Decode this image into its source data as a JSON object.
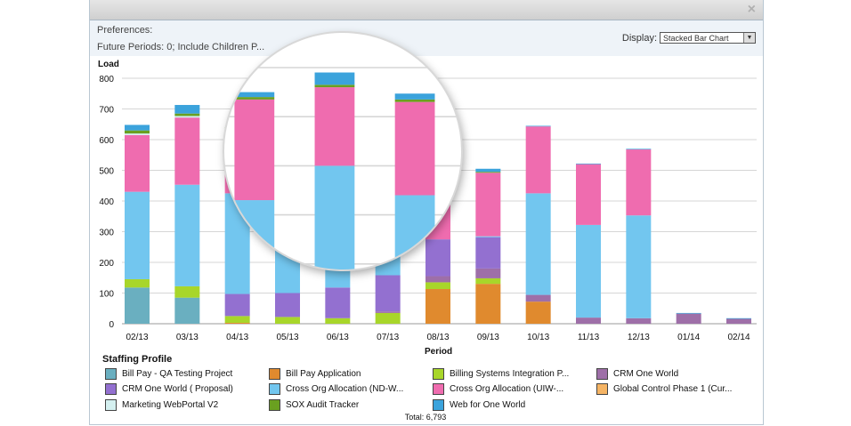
{
  "window": {
    "close_label": "×"
  },
  "preferences": {
    "title": "Preferences:",
    "summary": "Future Periods: 0; Include Children P...",
    "display_label": "Display:",
    "display_value": "Stacked Bar Chart"
  },
  "chart_data": {
    "type": "bar",
    "stacked": true,
    "ylabel": "Load",
    "xlabel": "Period",
    "ylim": [
      0,
      800
    ],
    "yticks": [
      0,
      100,
      200,
      300,
      400,
      500,
      600,
      700,
      800
    ],
    "grid": true,
    "categories": [
      "02/13",
      "03/13",
      "04/13",
      "05/13",
      "06/13",
      "07/13",
      "08/13",
      "09/13",
      "10/13",
      "11/13",
      "12/13",
      "01/14",
      "02/14"
    ],
    "legend_title": "Staffing Profile",
    "legend_position": "bottom",
    "series": [
      {
        "name": "Bill Pay - QA Testing Project",
        "color": "#6aafc0",
        "values": [
          118,
          85,
          0,
          0,
          0,
          0,
          0,
          0,
          0,
          0,
          0,
          0,
          0
        ]
      },
      {
        "name": "Bill Pay Application",
        "color": "#e08a2e",
        "values": [
          0,
          0,
          3,
          0,
          0,
          0,
          113,
          130,
          72,
          0,
          0,
          0,
          0
        ]
      },
      {
        "name": "Billing Systems Integration P...",
        "color": "#a8d62a",
        "values": [
          27,
          37,
          22,
          22,
          18,
          35,
          22,
          18,
          0,
          0,
          0,
          0,
          0
        ]
      },
      {
        "name": "CRM One World",
        "color": "#9e6fa8",
        "values": [
          0,
          0,
          0,
          0,
          0,
          5,
          20,
          32,
          22,
          20,
          18,
          33,
          16
        ]
      },
      {
        "name": "CRM One World ( Proposal)",
        "color": "#9370d0",
        "values": [
          0,
          0,
          72,
          78,
          100,
          118,
          120,
          102,
          0,
          0,
          0,
          0,
          0
        ]
      },
      {
        "name": "Cross Org Allocation (ND-W...",
        "color": "#72c6ef",
        "values": [
          285,
          331,
          328,
          330,
          382,
          282,
          0,
          3,
          331,
          302,
          335,
          0,
          0
        ]
      },
      {
        "name": "Cross Org Allocation (UIW-...",
        "color": "#ef6caf",
        "values": [
          185,
          219,
          210,
          205,
          160,
          190,
          220,
          207,
          218,
          198,
          215,
          0,
          0
        ]
      },
      {
        "name": "Global Control Phase 1 (Cur...",
        "color": "#f5b464",
        "values": [
          0,
          0,
          0,
          0,
          0,
          0,
          0,
          0,
          0,
          0,
          0,
          0,
          0
        ]
      },
      {
        "name": "Marketing WebPortal V2",
        "color": "#d4f0f0",
        "values": [
          5,
          5,
          0,
          0,
          0,
          0,
          0,
          0,
          0,
          0,
          0,
          0,
          0
        ]
      },
      {
        "name": "SOX Audit Tracker",
        "color": "#6aa020",
        "values": [
          10,
          8,
          5,
          5,
          5,
          5,
          5,
          3,
          0,
          0,
          0,
          0,
          0
        ]
      },
      {
        "name": "Web for One World",
        "color": "#3ba3dc",
        "values": [
          18,
          28,
          0,
          10,
          25,
          12,
          10,
          10,
          2,
          2,
          2,
          2,
          2
        ]
      }
    ],
    "total_label": "Total: 6,793"
  }
}
